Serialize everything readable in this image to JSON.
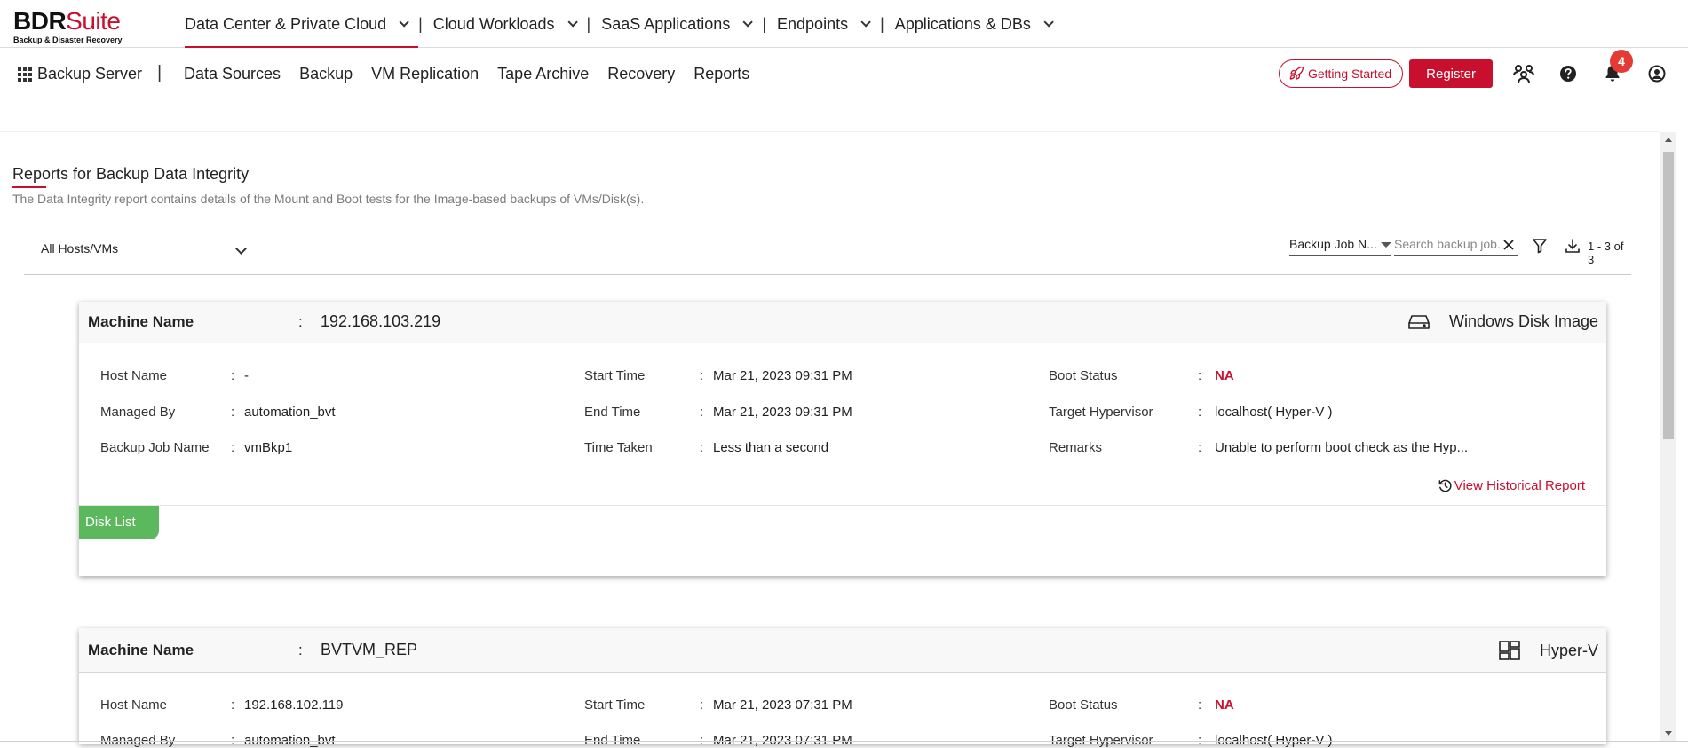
{
  "brand": {
    "name_dark": "BDR",
    "name_red": "Suite",
    "tagline": "Backup & Disaster Recovery"
  },
  "top_nav": [
    {
      "label": "Data Center & Private Cloud",
      "active": true
    },
    {
      "label": "Cloud Workloads"
    },
    {
      "label": "SaaS Applications"
    },
    {
      "label": "Endpoints"
    },
    {
      "label": "Applications & DBs"
    }
  ],
  "top_nav_separator": "|",
  "sub_nav": {
    "app_label": "Backup Server",
    "separator": "|",
    "items": [
      "Data Sources",
      "Backup",
      "VM Replication",
      "Tape Archive",
      "Recovery",
      "Reports"
    ]
  },
  "actions": {
    "getting_started": "Getting Started",
    "register": "Register",
    "notification_count": "4"
  },
  "icons": {
    "launcher": "grid-icon",
    "getting_started": "rocket-icon",
    "community": "people-icon",
    "help": "help-icon",
    "notifications": "bell-icon",
    "account": "user-icon",
    "filter": "filter-icon",
    "download": "download-icon",
    "clear": "close-icon",
    "history": "history-icon",
    "windows_disk": "hard-drive-icon",
    "hyperv": "hyperv-icon"
  },
  "colors": {
    "brand_red": "#c8102e",
    "badge_red": "#e53935",
    "disk_tab_green": "#5cb85c"
  },
  "page": {
    "title": "Reports for Backup Data Integrity",
    "description": "The Data Integrity report contains details of the Mount and Boot tests for the Image-based backups of VMs/Disk(s)."
  },
  "filters": {
    "host_select": "All Hosts/VMs",
    "job_select": "Backup Job N...",
    "search_placeholder": "Search backup job...",
    "pagination": "1 - 3 of 3"
  },
  "labels": {
    "machine_name": "Machine Name",
    "host_name": "Host Name",
    "managed_by": "Managed By",
    "backup_job_name": "Backup Job Name",
    "start_time": "Start Time",
    "end_time": "End Time",
    "time_taken": "Time Taken",
    "boot_status": "Boot Status",
    "target_hypervisor": "Target Hypervisor",
    "remarks": "Remarks",
    "colon": ":",
    "view_historical_report": "View Historical Report",
    "disk_list": "Disk List"
  },
  "reports": [
    {
      "machine_name": "192.168.103.219",
      "type": "Windows Disk Image",
      "host_name": "-",
      "managed_by": "automation_bvt",
      "backup_job_name": "vmBkp1",
      "start_time": "Mar 21, 2023 09:31 PM",
      "end_time": "Mar 21, 2023 09:31 PM",
      "time_taken": "Less than a second",
      "boot_status": "NA",
      "target_hypervisor": "localhost( Hyper-V )",
      "remarks": "Unable to perform boot check as the Hyp..."
    },
    {
      "machine_name": "BVTVM_REP",
      "type": "Hyper-V",
      "host_name": "192.168.102.119",
      "managed_by": "automation_bvt",
      "start_time": "Mar 21, 2023 07:31 PM",
      "end_time": "Mar 21, 2023 07:31 PM",
      "boot_status": "NA",
      "target_hypervisor": "localhost( Hyper-V )"
    }
  ]
}
